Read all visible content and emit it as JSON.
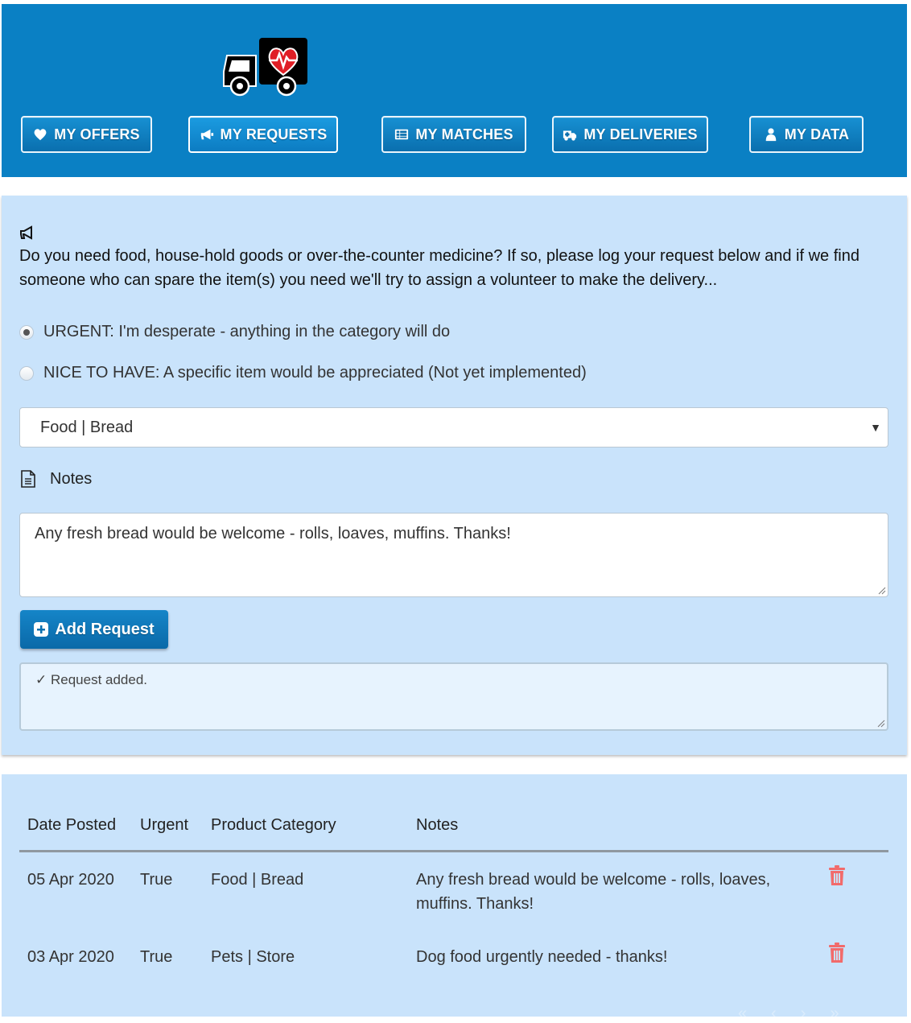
{
  "colors": {
    "header_bg": "#0a80c4",
    "panel_bg": "#c9e3fb",
    "button_blue": "#0a6fae",
    "trash_red": "#f26b6b",
    "heart_red": "#e01e25"
  },
  "nav": {
    "offers": {
      "label": "MY OFFERS",
      "icon": "heart-icon"
    },
    "requests": {
      "label": "MY REQUESTS",
      "icon": "megaphone-icon"
    },
    "matches": {
      "label": "MY MATCHES",
      "icon": "list-icon"
    },
    "deliveries": {
      "label": "MY DELIVERIES",
      "icon": "ambulance-icon"
    },
    "data": {
      "label": "MY DATA",
      "icon": "user-icon"
    }
  },
  "form": {
    "intro": "Do you need food, house-hold goods or over-the-counter medicine?  If so, please log your request below and if we find someone who can spare the item(s) you need we'll try to assign a volunteer to make the delivery...",
    "radio_urgent": "URGENT: I'm desperate - anything in the category will do",
    "radio_nice": "NICE TO HAVE: A specific item would be appreciated (Not yet implemented)",
    "category_selected": "Food | Bread",
    "notes_label": "Notes",
    "notes_value": "Any fresh bread would be welcome - rolls, loaves, muffins.  Thanks!",
    "add_button": "Add Request",
    "status": "✓ Request added."
  },
  "table": {
    "headers": {
      "date": "Date Posted",
      "urgent": "Urgent",
      "category": "Product Category",
      "notes": "Notes"
    },
    "rows": [
      {
        "date": "05 Apr 2020",
        "urgent": "True",
        "category": "Food | Bread",
        "notes": "Any fresh bread would be welcome - rolls, loaves, muffins.  Thanks!"
      },
      {
        "date": "03 Apr 2020",
        "urgent": "True",
        "category": "Pets | Store",
        "notes": "Dog food urgently needed - thanks!"
      }
    ]
  }
}
